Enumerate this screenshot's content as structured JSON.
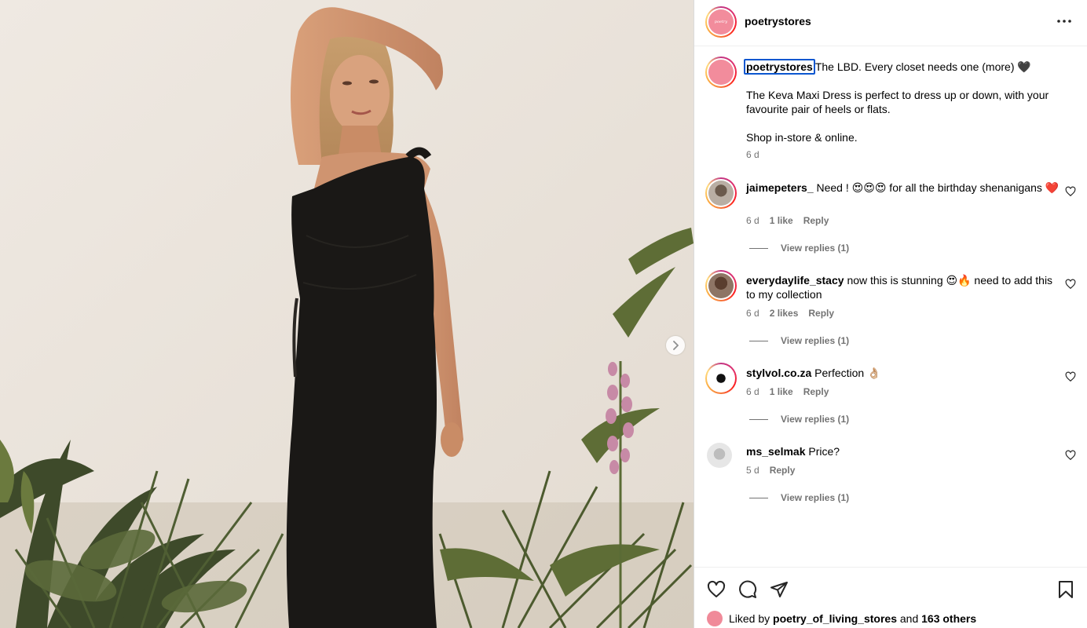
{
  "post": {
    "username": "poetrystores",
    "avatar_brand_color": "#f28c9c",
    "avatar_logo_text": "poetry"
  },
  "caption": {
    "username": "poetrystores",
    "first_line": "The LBD. Every closet needs one (more) 🖤",
    "paragraph": "The Keva Maxi Dress is perfect to dress up or down, with your favourite pair of heels or flats.",
    "shop_line": "Shop in-store & online.",
    "time": "6 d"
  },
  "comments": [
    {
      "username": "jaimepeters_",
      "text": "Need ! 😍😍😍 for all the birthday shenanigans ❤️",
      "time": "6 d",
      "likes": "1 like",
      "reply": "Reply",
      "view_replies": "View replies (1)"
    },
    {
      "username": "everydaylife_stacy",
      "text": "now this is stunning 😍🔥 need to add this to my collection",
      "time": "6 d",
      "likes": "2 likes",
      "reply": "Reply",
      "view_replies": "View replies (1)"
    },
    {
      "username": "stylvol.co.za",
      "text": "Perfection 👌🏼",
      "time": "6 d",
      "likes": "1 like",
      "reply": "Reply",
      "view_replies": "View replies (1)"
    },
    {
      "username": "ms_selmak",
      "text": "Price?",
      "time": "5 d",
      "likes": "",
      "reply": "Reply",
      "view_replies": "View replies (1)"
    }
  ],
  "footer": {
    "liked_prefix": "Liked by",
    "liked_user": "poetry_of_living_stores",
    "liked_and": "and",
    "liked_others": "163 others"
  },
  "icons": [
    "chevron-right-icon",
    "more-horizontal-icon",
    "heart-icon",
    "comment-icon",
    "share-icon",
    "bookmark-icon"
  ]
}
